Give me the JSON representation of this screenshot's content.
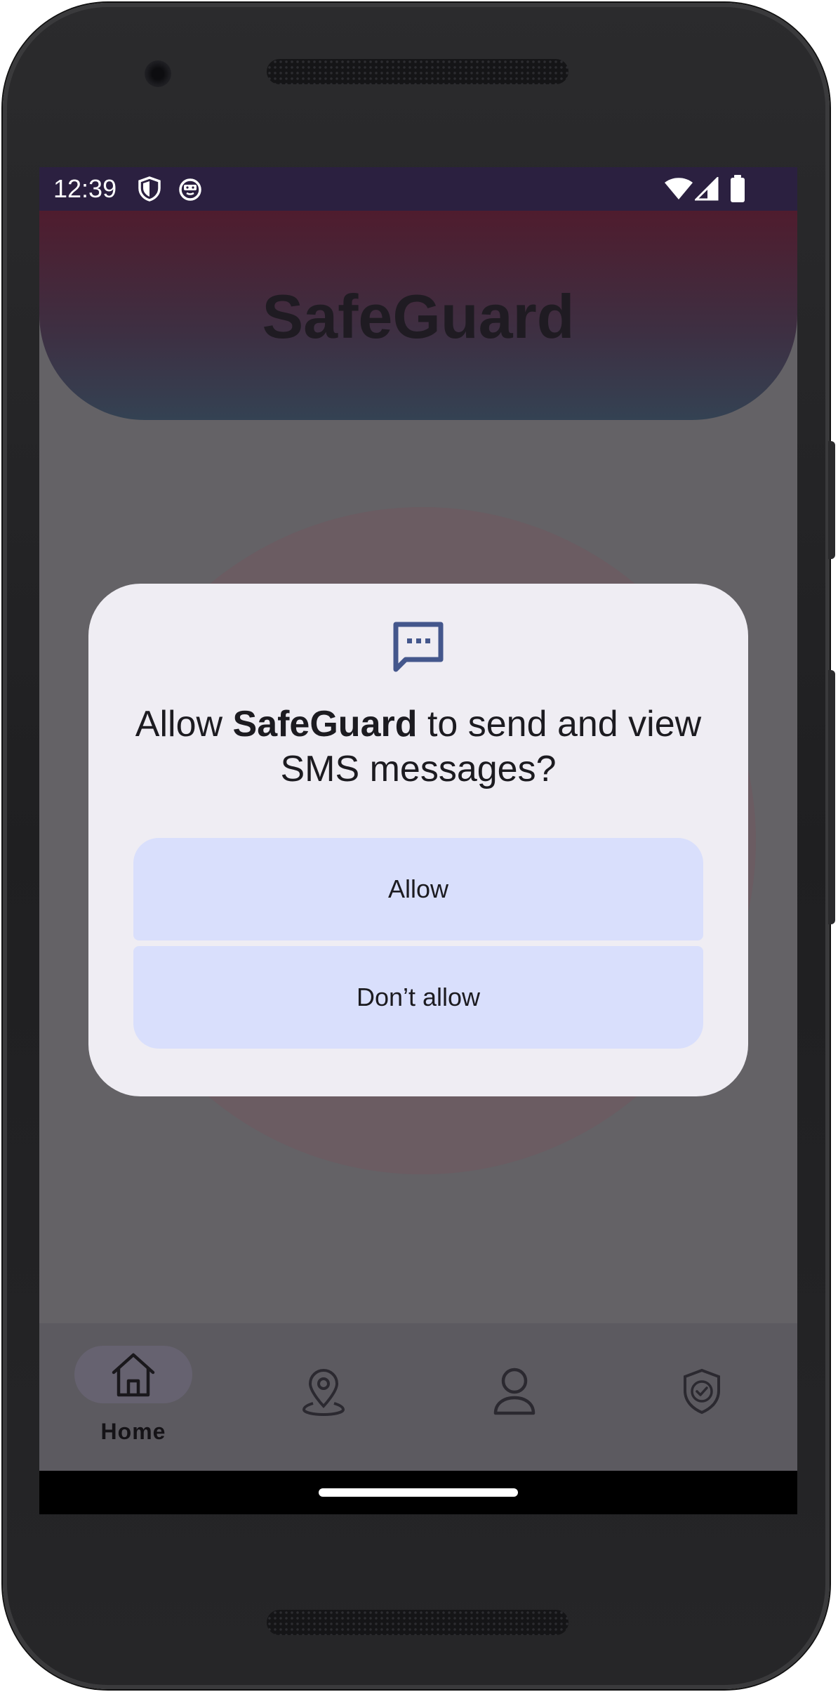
{
  "status_bar": {
    "time": "12:39",
    "icons": [
      "shield-icon",
      "robot-icon",
      "wifi-icon",
      "cellular-icon",
      "battery-icon"
    ]
  },
  "app": {
    "title": "SafeGuard"
  },
  "permission_dialog": {
    "icon": "sms-message-icon",
    "title_prefix": "Allow ",
    "title_app": "SafeGuard",
    "title_suffix": " to send and view SMS messages?",
    "allow_label": "Allow",
    "deny_label": "Don’t allow"
  },
  "bottom_nav": {
    "items": [
      {
        "icon": "home-icon",
        "label": "Home",
        "active": true
      },
      {
        "icon": "location-pin-icon",
        "label": ""
      },
      {
        "icon": "profile-icon",
        "label": ""
      },
      {
        "icon": "shield-check-icon",
        "label": ""
      }
    ]
  },
  "colors": {
    "status_bar": "#2b2040",
    "header_top": "#4f1c2e",
    "header_bottom": "#344253",
    "dialog_bg": "#efedf3",
    "button_bg": "#d9dffc",
    "dialog_icon": "#44578c"
  }
}
